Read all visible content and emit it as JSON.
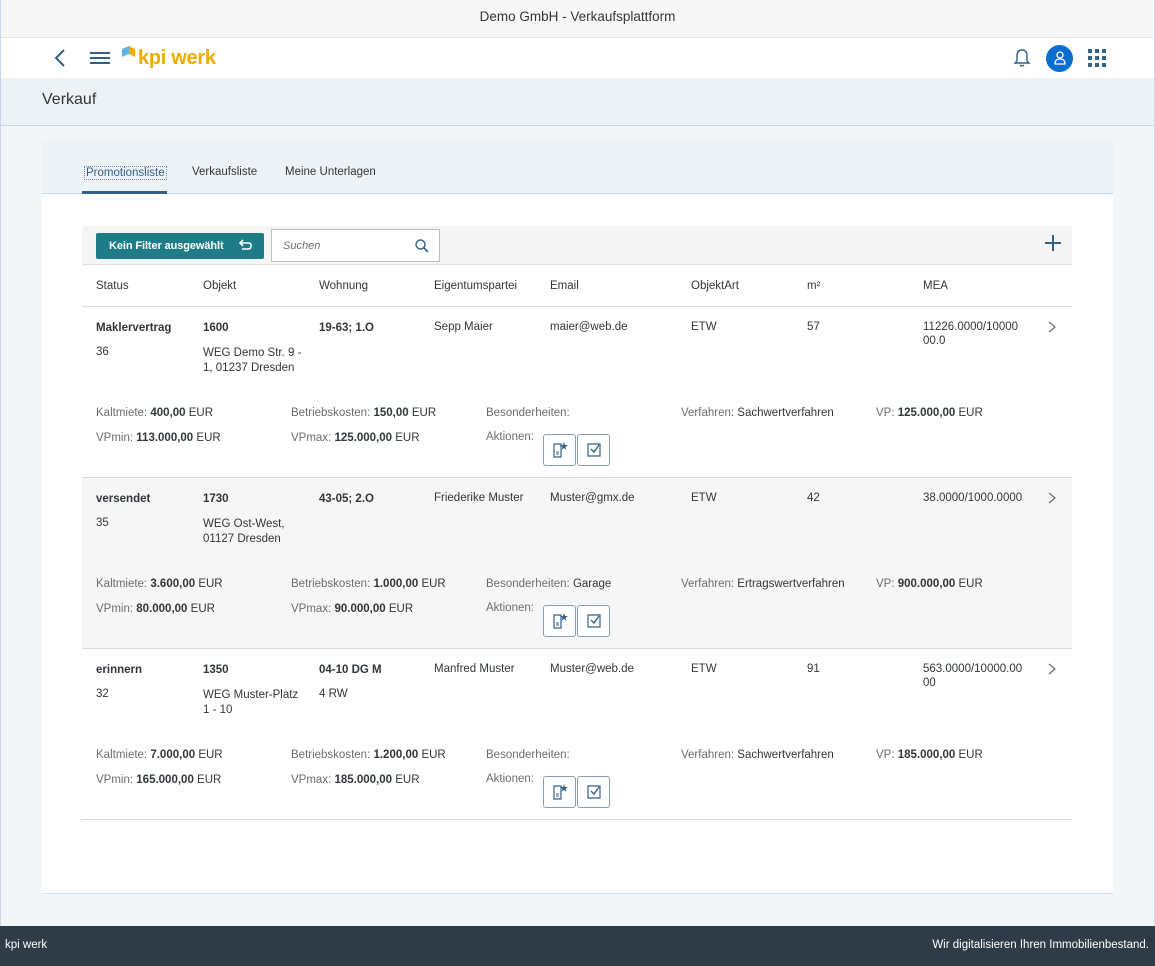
{
  "window": {
    "title": "Demo GmbH - Verkaufsplattform"
  },
  "shell": {
    "logo_text": "kpi werk"
  },
  "page": {
    "title": "Verkauf"
  },
  "tabs": [
    {
      "label": "Promotionsliste",
      "active": true
    },
    {
      "label": "Verkaufsliste",
      "active": false
    },
    {
      "label": "Meine Unterlagen",
      "active": false
    }
  ],
  "toolbar": {
    "filter_label": "Kein Filter ausgewählt",
    "search_placeholder": "Suchen"
  },
  "columns": [
    "Status",
    "Objekt",
    "Wohnung",
    "Eigentumspartei",
    "Email",
    "ObjektArt",
    "m²",
    "MEA"
  ],
  "detail_labels": {
    "kaltmiete": "Kaltmiete:",
    "betriebskosten": "Betriebskosten:",
    "besonderheiten": "Besonderheiten:",
    "verfahren": "Verfahren:",
    "vp": "VP:",
    "vpmin": "VPmin:",
    "vpmax": "VPmax:",
    "aktionen": "Aktionen:",
    "currency": "EUR"
  },
  "rows": [
    {
      "status": "Maklervertrag",
      "status_num": "36",
      "objekt_nr": "1600",
      "objekt_line1": "WEG Demo Str. 9 -",
      "objekt_line2": "1, 01237 Dresden",
      "wohnung": "19-63; 1.O",
      "wohnung_sub": "",
      "eigentuemer": "Sepp Maier",
      "email": "maier@web.de",
      "art": "ETW",
      "qm": "57",
      "mea_line1": "11226.0000/10000",
      "mea_line2": "00.0",
      "kaltmiete": "400,00",
      "betriebskosten": "150,00",
      "besonderheiten": "",
      "verfahren": "Sachwertverfahren",
      "vp": "125.000,00",
      "vpmin": "113.000,00",
      "vpmax": "125.000,00"
    },
    {
      "status": "versendet",
      "status_num": "35",
      "objekt_nr": "1730",
      "objekt_line1": "WEG Ost-West,",
      "objekt_line2": "01127 Dresden",
      "wohnung": "43-05; 2.O",
      "wohnung_sub": "",
      "eigentuemer": "Friederike Muster",
      "email": "Muster@gmx.de",
      "art": "ETW",
      "qm": "42",
      "mea_line1": "38.0000/1000.0000",
      "mea_line2": "",
      "kaltmiete": "3.600,00",
      "betriebskosten": "1.000,00",
      "besonderheiten": "Garage",
      "verfahren": "Ertragswertverfahren",
      "vp": "900.000,00",
      "vpmin": "80.000,00",
      "vpmax": "90.000,00"
    },
    {
      "status": "erinnern",
      "status_num": "32",
      "objekt_nr": "1350",
      "objekt_line1": "WEG Muster-Platz",
      "objekt_line2": "1 - 10",
      "wohnung": "04-10 DG M",
      "wohnung_sub": "4 RW",
      "eigentuemer": "Manfred Muster",
      "email": "Muster@web.de",
      "art": "ETW",
      "qm": "91",
      "mea_line1": "563.0000/10000.00",
      "mea_line2": "00",
      "kaltmiete": "7.000,00",
      "betriebskosten": "1.200,00",
      "besonderheiten": "",
      "verfahren": "Sachwertverfahren",
      "vp": "185.000,00",
      "vpmin": "165.000,00",
      "vpmax": "185.000,00"
    }
  ],
  "footer": {
    "left": "kpi werk",
    "right": "Wir digitalisieren Ihren Immobilienbestand."
  },
  "colors": {
    "accent": "#1e7c87",
    "shell_blue": "#0a6ed1",
    "footer_bg": "#2f3c48",
    "logo": "#f0ab00"
  }
}
